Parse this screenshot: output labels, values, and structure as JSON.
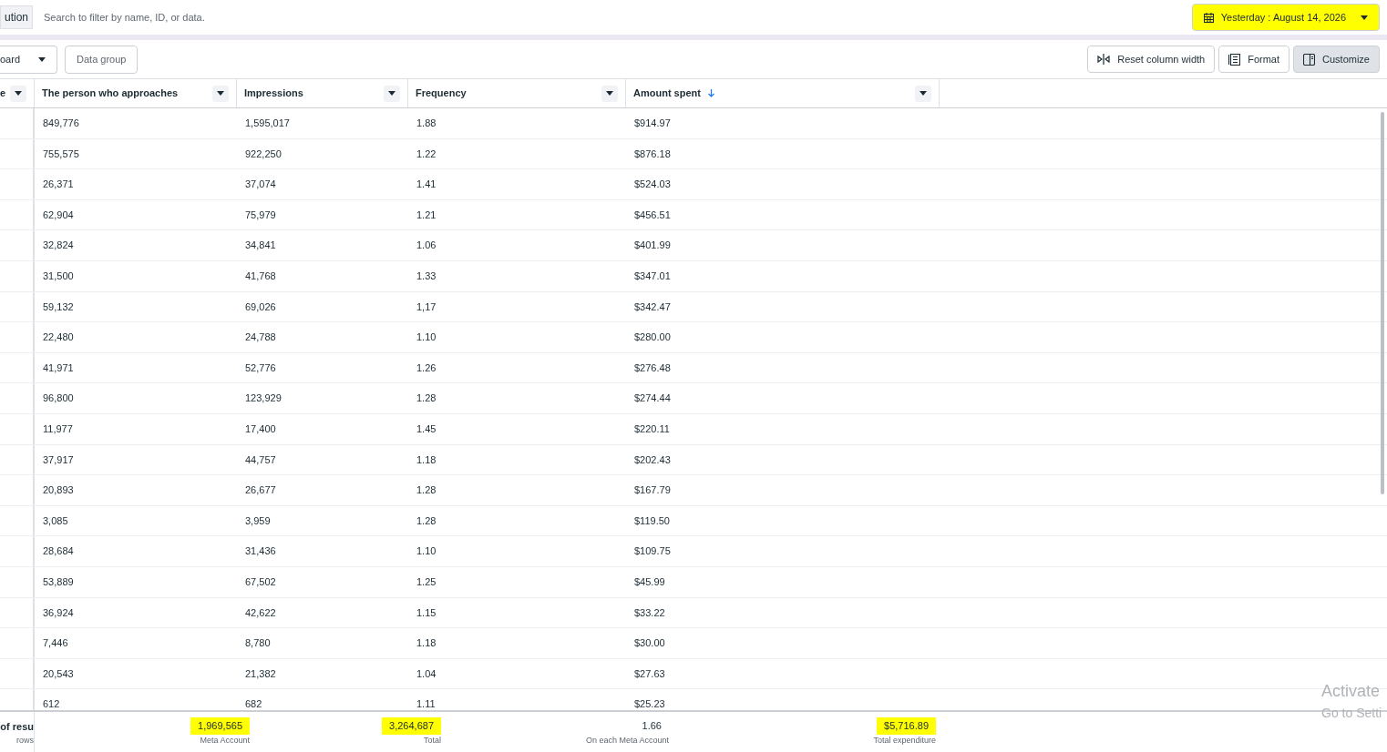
{
  "top_bar": {
    "chip": "ution",
    "search": {
      "placeholder": "Search to filter by name, ID, or data."
    },
    "date_button": {
      "label": "Yesterday : August 14, 2026",
      "highlighted": true
    }
  },
  "toolbar": {
    "left": [
      {
        "label": "oard",
        "kind": "dropdown"
      },
      {
        "label": "Data group",
        "kind": "plain"
      }
    ],
    "right": [
      {
        "label": "Reset column width",
        "selected": false
      },
      {
        "label": "Format",
        "selected": false
      },
      {
        "label": "Customize",
        "selected": true
      }
    ]
  },
  "table": {
    "columns": [
      {
        "label": "e",
        "sorted": false
      },
      {
        "label": "The person who approaches",
        "sorted": false
      },
      {
        "label": "Impressions",
        "sorted": false
      },
      {
        "label": "Frequency",
        "sorted": false
      },
      {
        "label": "Amount spent",
        "sorted": true
      }
    ],
    "rows": [
      [
        "",
        "849,776",
        "1,595,017",
        "1.88",
        "$914.97"
      ],
      [
        "",
        "755,575",
        "922,250",
        "1.22",
        "$876.18"
      ],
      [
        "",
        "26,371",
        "37,074",
        "1.41",
        "$524.03"
      ],
      [
        "",
        "62,904",
        "75,979",
        "1.21",
        "$456.51"
      ],
      [
        "",
        "32,824",
        "34,841",
        "1.06",
        "$401.99"
      ],
      [
        "",
        "31,500",
        "41,768",
        "1.33",
        "$347.01"
      ],
      [
        "",
        "59,132",
        "69,026",
        "1,17",
        "$342.47"
      ],
      [
        "",
        "22,480",
        "24,788",
        "1.10",
        "$280.00"
      ],
      [
        "",
        "41,971",
        "52,776",
        "1.26",
        "$276.48"
      ],
      [
        "",
        "96,800",
        "123,929",
        "1.28",
        "$274.44"
      ],
      [
        "",
        "11,977",
        "17,400",
        "1.45",
        "$220.11"
      ],
      [
        "",
        "37,917",
        "44,757",
        "1.18",
        "$202.43"
      ],
      [
        "",
        "20,893",
        "26,677",
        "1.28",
        "$167.79"
      ],
      [
        "",
        "3,085",
        "3,959",
        "1.28",
        "$119.50"
      ],
      [
        "",
        "28,684",
        "31,436",
        "1.10",
        "$109.75"
      ],
      [
        "",
        "53,889",
        "67,502",
        "1.25",
        "$45.99"
      ],
      [
        "",
        "36,924",
        "42,622",
        "1.15",
        "$33.22"
      ],
      [
        "",
        "7,446",
        "8,780",
        "1.18",
        "$30.00"
      ],
      [
        "",
        "20,543",
        "21,382",
        "1.04",
        "$27.63"
      ],
      [
        "",
        "612",
        "682",
        "1.11",
        "$25.23"
      ]
    ]
  },
  "summary": {
    "first": {
      "value": "of resu",
      "caption": "rows"
    },
    "totals": [
      {
        "value": "1,969,565",
        "caption": "Meta Account",
        "highlighted": true
      },
      {
        "value": "3,264,687",
        "caption": "Total",
        "highlighted": true
      },
      {
        "value": "1.66",
        "caption": "On each Meta Account",
        "highlighted": false
      },
      {
        "value": "$5,716.89",
        "caption": "Total expenditure",
        "highlighted": true
      }
    ]
  },
  "os_notice": {
    "title": "Activate",
    "subtitle": "Go to Setti"
  }
}
